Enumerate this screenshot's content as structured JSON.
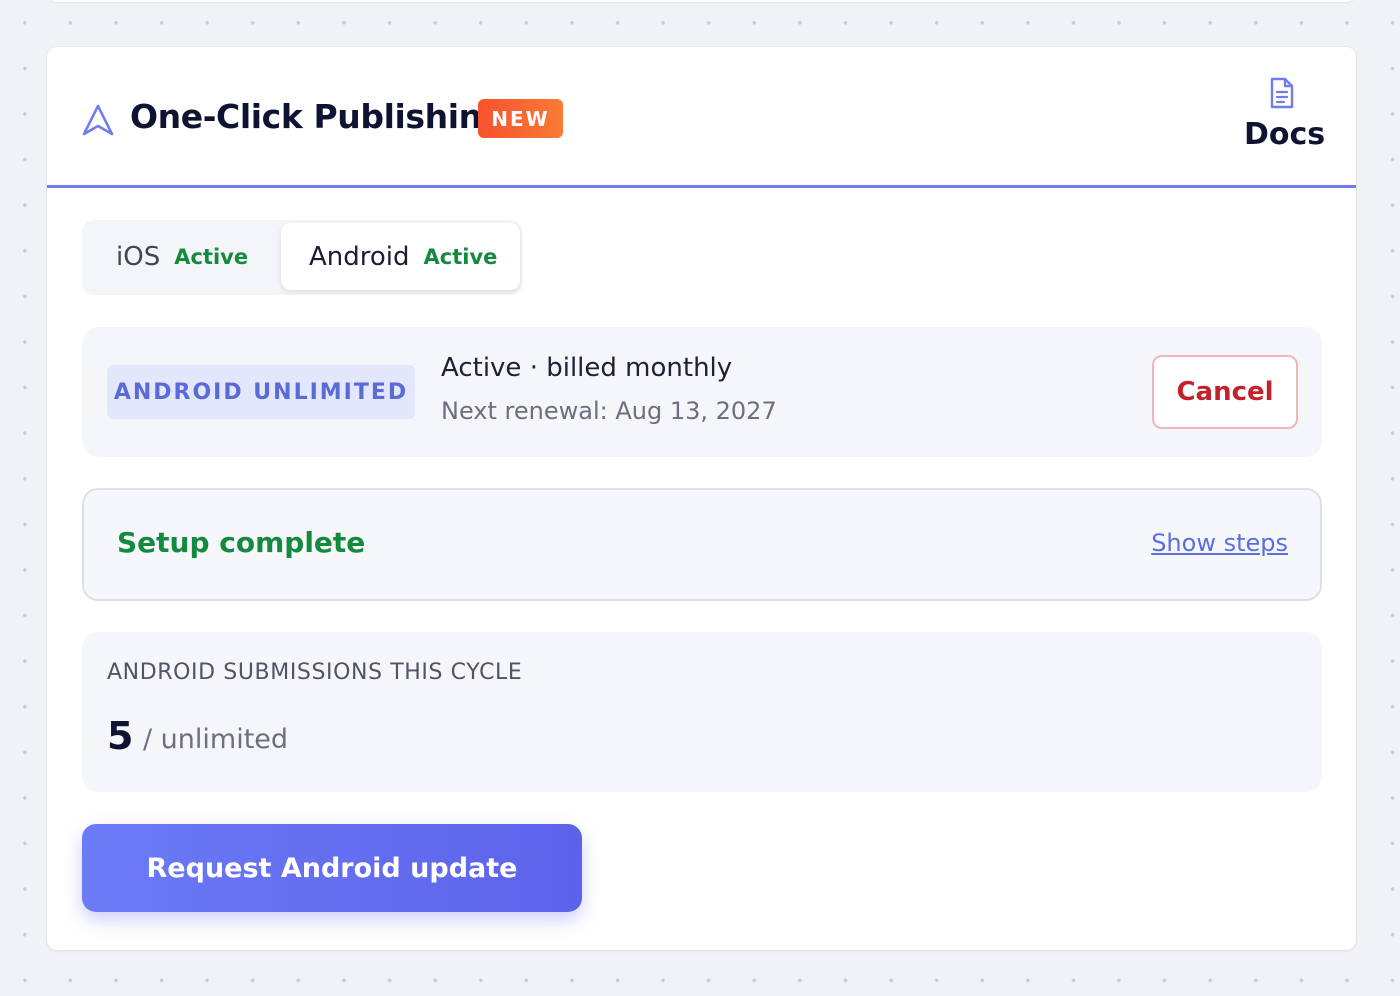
{
  "header": {
    "title": "One-Click Publishing",
    "badge": "NEW",
    "docs_label": "Docs",
    "title_icon": "navigation-arrow-icon",
    "docs_icon": "document-icon"
  },
  "tabs": [
    {
      "name": "iOS",
      "status": "Active",
      "selected": false
    },
    {
      "name": "Android",
      "status": "Active",
      "selected": true
    }
  ],
  "plan": {
    "badge": "ANDROID UNLIMITED",
    "status": "Active · billed monthly",
    "renewal": "Next renewal: Aug 13, 2027",
    "cancel_label": "Cancel"
  },
  "setup": {
    "status": "Setup complete",
    "link_label": "Show steps"
  },
  "usage": {
    "label": "ANDROID SUBMISSIONS THIS CYCLE",
    "count": "5",
    "limit": "/ unlimited"
  },
  "actions": {
    "request_label": "Request Android update"
  },
  "colors": {
    "accent": "#6f7df0",
    "success": "#148a3e",
    "danger": "#c3222a",
    "badge_new": "#f6522e"
  }
}
